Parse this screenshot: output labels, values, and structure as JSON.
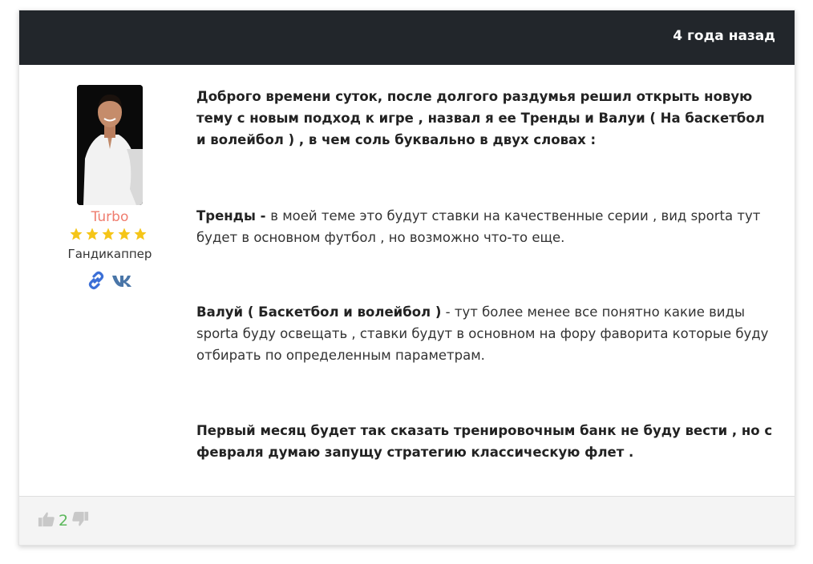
{
  "header": {
    "timestamp": "4 года назад"
  },
  "author": {
    "username": "Turbo",
    "rating_stars": 5,
    "rating_max": 5,
    "role": "Гандикаппер",
    "social_icons": [
      "link-icon",
      "vk-icon"
    ]
  },
  "post": {
    "p1": "Доброго времени суток, после долгого раздумья решил открыть новую тему с новым подход к игре , назвал я ее Тренды и Валуи ( На баскетбол и волейбол ) , в чем соль буквально в двух словах :",
    "p2_bold": "Тренды - ",
    "p2_text": "в моей теме это будут ставки на качественные серии , вид sporta тут будет в основном футбол , но возможно что-то еще.",
    "p3_bold": "Валуй ( Баскетбол и волейбол )",
    "p3_text": " - тут более менее все понятно какие виды sporta буду освещать , ставки будут в основном на фору фаворита которые буду отбирать по определенным параметрам.",
    "p4": "Первый месяц будет так сказать тренировочным банк не буду вести , но с февраля думаю запущу стратегию классическую флет ."
  },
  "footer": {
    "likes": "2"
  },
  "colors": {
    "header_bg": "#22262b",
    "username": "#ef7c6e",
    "star": "#f5c518",
    "like_count": "#5cb85c",
    "social_link": "#3b6fd6",
    "social_vk": "#4a76a8"
  }
}
